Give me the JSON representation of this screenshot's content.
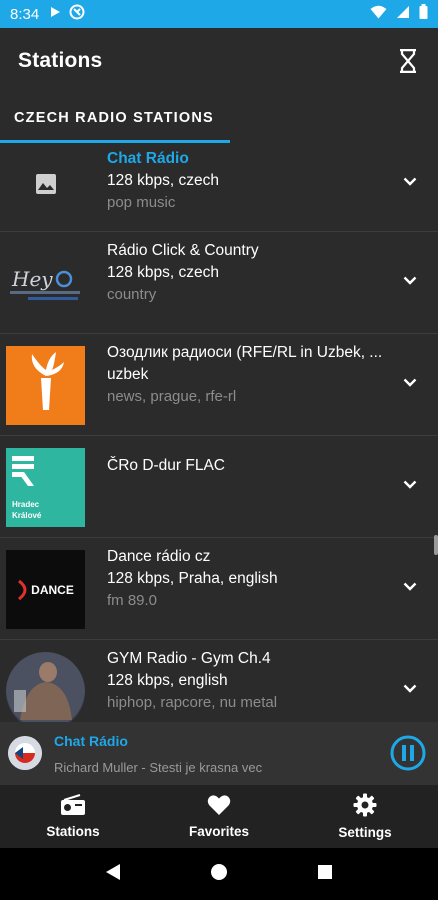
{
  "status_bar": {
    "time": "8:34"
  },
  "app_bar": {
    "title": "Stations"
  },
  "tabs": [
    {
      "label": "CZECH RADIO STATIONS",
      "selected": true
    }
  ],
  "stations": [
    {
      "name": "Chat Rádio",
      "info": "128 kbps, czech",
      "tags": "pop music",
      "active": true,
      "logo": "image-placeholder-icon"
    },
    {
      "name": "Rádio Click & Country",
      "info": "128 kbps, czech",
      "tags": "country",
      "logo": "hey-radio-logo"
    },
    {
      "name": "Озодлик радиоси (RFE/RL in Uzbek, ...",
      "info": "uzbek",
      "tags": "news, prague, rfe-rl",
      "logo": "rfe-rl-torch-logo"
    },
    {
      "name": "ČRo D-dur FLAC",
      "info": "",
      "tags": "",
      "logo": "cro-hradec-kralove-logo",
      "logo_text": "Hradec Králové"
    },
    {
      "name": "Dance rádio cz",
      "info": "128 kbps, Praha, english",
      "tags": "fm 89.0",
      "logo": "dance-radio-logo",
      "logo_text": "DANCE"
    },
    {
      "name": "GYM Radio - Gym Ch.4",
      "info": "128 kbps, english",
      "tags": "hiphop, rapcore, nu metal",
      "logo": "gym-photo"
    }
  ],
  "player": {
    "title": "Chat Rádio",
    "track": "Richard Muller - Stesti je krasna vec",
    "state": "playing"
  },
  "bottom_nav": [
    {
      "label": "Stations",
      "icon": "radio-icon",
      "selected": true
    },
    {
      "label": "Favorites",
      "icon": "heart-icon"
    },
    {
      "label": "Settings",
      "icon": "gear-icon"
    }
  ],
  "colors": {
    "accent": "#1ea8e8",
    "background": "#2b2b2b",
    "rfe_orange": "#f07d1a",
    "cro_teal": "#2fb6a0"
  }
}
